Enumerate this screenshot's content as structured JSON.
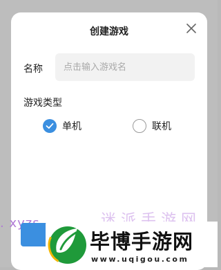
{
  "dialog": {
    "title": "创建游戏",
    "close_icon": "close-icon",
    "name_field": {
      "label": "名称",
      "value": "",
      "placeholder": "点击输入游戏名"
    },
    "game_type": {
      "label": "游戏类型",
      "options": [
        {
          "label": "单机",
          "selected": true
        },
        {
          "label": "联机",
          "selected": false
        }
      ]
    },
    "accent_color": "#3b8fe0"
  },
  "watermark": {
    "left_text": ". xyzs",
    "right_text": "迷 派 手 游 网",
    "brand": "毕博手游网",
    "url": "www.uqigou.com",
    "logo_icon": "leaf-logo-icon"
  }
}
